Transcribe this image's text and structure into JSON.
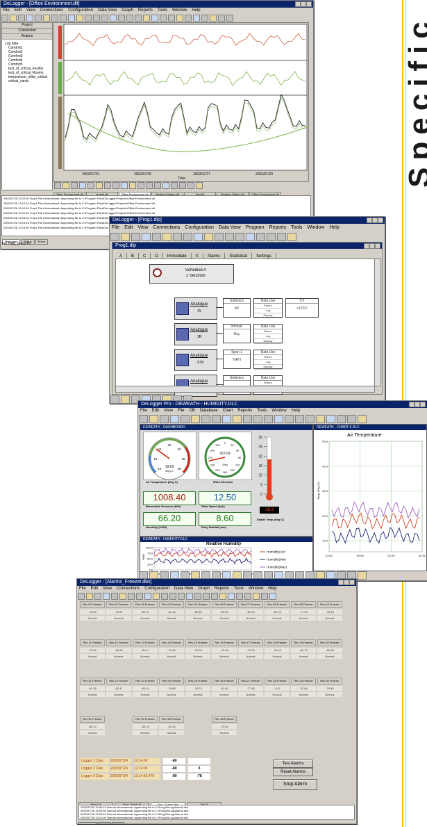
{
  "side_title": "Specific",
  "colors": {
    "accent_line": "#f5c400",
    "title_bar": "#0a246a",
    "red_series": "#c86040",
    "green_series": "#7fb24a",
    "dark_series": "#303030"
  },
  "win1": {
    "title": "DeLogger - [Office Environment.dlt]",
    "menu": [
      "File",
      "Edit",
      "View",
      "Connections",
      "Configuration",
      "Data View",
      "Graph",
      "Reports",
      "Tools",
      "Window",
      "Help"
    ],
    "panel_header": "Project",
    "panel_rows": [
      "Connection",
      "Actions"
    ],
    "tree_items": [
      "Log data",
      "Comfort1",
      "Comfort2",
      "Comfort3",
      "Comfort4",
      "Comfort5",
      "test_of_critical_Facility",
      "test_of_critical_Rooms",
      "tempsensor_slide_critical",
      "critical_cards"
    ],
    "axis_dates": [
      "2002/07/23",
      "2002/07/25",
      "2002/07/27",
      "2002/07/29"
    ],
    "axis_title": "Time",
    "tabs": [
      "Office Environment.dlt",
      "Humid.dlt",
      "Office Environment.dlt",
      "Weather Station.dlt",
      "Test.dlt",
      "Weather Station.dlt",
      "Office Environment.dlt",
      "Office Environment.dlt"
    ],
    "log_rows": [
      "2002/07/26 13:12:00 Prop1 File Informational: Appending file to C:\\Program Files\\DeLogger\\Projects\\Office Environment.dlt",
      "2002/07/26 13:12:15 Prop1 File Informational: Appending file to C:\\Program Files\\DeLogger\\Projects\\Office Environment.dlt",
      "2002/07/26 13:12:30 Prop1 File Informational: Appending file to C:\\Program Files\\DeLogger\\Projects\\Office Environment.dlt",
      "2002/07/26 13:12:45 Prop1 File Informational: Appending file to C:\\Program Files\\DeLogger\\Projects\\Office Environment.dlt",
      "2002/07/26 13:13:00 Prop1 File Informational: Appending file to C:\\Program Files\\DeLogger\\Projects\\Office Environment.dlt",
      "2002/07/26 13:13:15 Prop1 File Informational: Appending file to C:\\Program Files\\DeLogger\\Projects\\Office Environment.dlt",
      "2002/07/26 13:13:30 Prop1 File Informational: Appending file to C:\\Program Files\\DeLogger\\Projects\\Office Environment.dlt"
    ],
    "bottom_tabs": [
      "Messages",
      "Status",
      "Errors"
    ],
    "status": "For Help, press F1"
  },
  "win2": {
    "title": "DeLogger - [Prog1.dlp]",
    "menu": [
      "File",
      "Edit",
      "View",
      "Connections",
      "Configuration",
      "Data View",
      "Program",
      "Reports",
      "Tools",
      "Window",
      "Help"
    ],
    "inner_title": "Prog1.dlp",
    "tabs": [
      "A",
      "B",
      "C",
      "D",
      "Immediate",
      "X",
      "Alarms",
      "Statistical",
      "Settings"
    ],
    "schedule": {
      "name": "Schedule A",
      "rate": "1 Seconds"
    },
    "rows": [
      {
        "sensor": "Analogue",
        "range": "1V",
        "stat": "Statistics",
        "stat_val": "AV",
        "use": "Data Use",
        "use_items": [
          "Return",
          "Log",
          "Display"
        ],
        "extra": "CV",
        "extra_val": "<12CV"
      },
      {
        "sensor": "Analogue",
        "range": "3R",
        "stat": "Intrinsic",
        "stat_val": "Day",
        "use": "Data Use",
        "use_items": [
          "Return",
          "Log",
          "Display"
        ],
        "extra": "",
        "extra_val": ""
      },
      {
        "sensor": "Analogue",
        "range": "STK",
        "stat": "Span 1",
        "stat_val": "%RH",
        "use": "Data Use",
        "use_items": [
          "Return",
          "Log",
          "Display"
        ],
        "extra": "",
        "extra_val": ""
      },
      {
        "sensor": "Analogue",
        "range": "",
        "stat": "Statistics",
        "stat_val": "",
        "use": "Data Use",
        "use_items": [
          "Return"
        ],
        "extra": "",
        "extra_val": ""
      }
    ]
  },
  "win3": {
    "title": "DeLogger Pro - DEWEATH - HUMIDITY.DLC",
    "menu": [
      "File",
      "Edit",
      "View",
      "File",
      "DB",
      "Database",
      "Chart",
      "Reports",
      "Tools",
      "Window",
      "Help"
    ],
    "panel1_title": "DEWEATH - DASHBOARD",
    "panel2_title": "DEWEATH - CHART 6.DLC",
    "panel3_title": "DEWEATH - HUMIDITY.DLC",
    "gauge1": {
      "label": "Air Temperature (Deg C)",
      "value": "19.00",
      "unit": "Deg C",
      "ticks": [
        "10",
        "15",
        "20",
        "25",
        "30",
        "35",
        "40"
      ],
      "reading": 19.0,
      "min": 10,
      "max": 40
    },
    "gauge2": {
      "label": "Wind Direction",
      "value": "257.09",
      "unit": "Deg",
      "ticks": [
        "300",
        "330",
        "0",
        "30",
        "60",
        "90",
        "120",
        "150",
        "180",
        "210",
        "240",
        "270"
      ],
      "reading": 257.09
    },
    "thermo": {
      "label": "Shade Temp (Deg C)",
      "ticks": [
        "30",
        "25",
        "20",
        "15",
        "10",
        "5",
        "0"
      ],
      "reading": "18.3",
      "value": 18.3
    },
    "digits": [
      {
        "value": "1008.40",
        "label": "Barometric Pressure (hPa)",
        "color": "#a02010"
      },
      {
        "value": "12.50",
        "label": "Wind Speed (kph)",
        "color": "#1a5fa0"
      },
      {
        "value": "66.20",
        "label": "Humidity (%RH)",
        "color": "#2a7a20"
      },
      {
        "value": "8.60",
        "label": "Daily Rainfall (mm)",
        "color": "#2a7a20"
      }
    ],
    "rh_title": "Relative Humidity",
    "rh_legend": [
      "Humidity(Avr)",
      "Humidity(Min)",
      "Humidity(Max)"
    ],
    "rh_x": [
      "00:01:45",
      "00:02:05",
      "00:02:25",
      "00:02:45"
    ],
    "rh_y": [
      "100.0",
      "75.0",
      "50.0",
      "25.0",
      "0.0"
    ],
    "rh_ylabel": "%RH",
    "air_title": "Air Temperature",
    "air_y": [
      "50.0",
      "40.0",
      "30.0",
      "20.0",
      "10.0"
    ],
    "air_x": [
      "01:01",
      "02:06",
      "02:29",
      "02:31"
    ],
    "air_ylabel": "Temp (Deg C)",
    "status": "For Help, press F1"
  },
  "win4": {
    "title": "DeLogger - [Alarms_Freezer.dbx]",
    "menu": [
      "File",
      "Edit",
      "View",
      "Connections",
      "Configuration",
      "Data View",
      "Graph",
      "Reports",
      "Tools",
      "Window",
      "Help"
    ],
    "rows": [
      [
        {
          "h": "Rev 01 Freezer",
          "v": "-78.94",
          "s": "Normal"
        },
        {
          "h": "Rev 02 Freezer",
          "v": "-79.87",
          "s": "Normal"
        },
        {
          "h": "Rev 03 Freezer",
          "v": "-80.15",
          "s": "Normal"
        },
        {
          "h": "Rev 04 Freezer",
          "v": "-81.43",
          "s": "Normal"
        },
        {
          "h": "Rev 05 Freezer",
          "v": "-81.84",
          "s": "Normal"
        },
        {
          "h": "Rev 06 Freezer",
          "v": "-81.80",
          "s": "Normal"
        },
        {
          "h": "Rev 07 Freezer",
          "v": "-80.13",
          "s": "Normal"
        },
        {
          "h": "Rev 08 Freezer",
          "v": "-81.76",
          "s": "Normal"
        },
        {
          "h": "Rev 09 Freezer",
          "v": "-77.49",
          "s": "Normal"
        },
        {
          "h": "Rev 10 Freezer",
          "v": "-78.40",
          "s": "Normal"
        }
      ],
      [
        {
          "h": "Rev 11 Freezer",
          "v": "-79.34",
          "s": "Normal"
        },
        {
          "h": "Rev 12 Freezer",
          "v": "-80.34",
          "s": "Normal"
        },
        {
          "h": "Rev 13 Freezer",
          "v": "-80.47",
          "s": "Normal"
        },
        {
          "h": "Rev 14 Freezer",
          "v": "-79.99",
          "s": "Normal"
        },
        {
          "h": "Rev 15 Freezer",
          "v": "-79.99",
          "s": "Normal"
        },
        {
          "h": "Rev 16 Freezer",
          "v": "-79.63",
          "s": "Normal"
        },
        {
          "h": "Rev 17 Freezer",
          "v": "-79.70",
          "s": "Normal"
        },
        {
          "h": "Rev 18 Freezer",
          "v": "-79.43",
          "s": "Normal"
        },
        {
          "h": "Rev 19 Freezer",
          "v": "-80.79",
          "s": "Normal"
        },
        {
          "h": "Rev 20 Freezer",
          "v": "-80.43",
          "s": "Normal"
        }
      ],
      [
        {
          "h": "Rev 21 Freezer",
          "v": "-81.35",
          "s": "Normal"
        },
        {
          "h": "Rev 22 Freezer",
          "v": "-82.41",
          "s": "Normal"
        },
        {
          "h": "Rev 23 Freezer",
          "v": "-80.41",
          "s": "Normal"
        },
        {
          "h": "Rev 24 Freezer",
          "v": "-79.88",
          "s": "Normal"
        },
        {
          "h": "Rev 25 Freezer",
          "v": "-78.72",
          "s": "Normal"
        },
        {
          "h": "Rev 26 Freezer",
          "v": "-81.60",
          "s": "Normal"
        },
        {
          "h": "Rev 27 Freezer",
          "v": "-77.46",
          "s": "Normal"
        },
        {
          "h": "Rev 28 Freezer",
          "v": "-4.47",
          "s": "Normal"
        },
        {
          "h": "Rev 29 Freezer",
          "v": "-22.84",
          "s": "Normal"
        },
        {
          "h": "Rev 30 Freezer",
          "v": "-23.40",
          "s": "Normal"
        }
      ],
      [
        {
          "h": "Rev 31 Freezer",
          "v": "-80.10",
          "s": "Normal"
        },
        {
          "h": "",
          "v": "",
          "s": ""
        },
        {
          "h": "Rev 33 Freezer",
          "v": "-80.15",
          "s": "Normal"
        },
        {
          "h": "Rev 34 Freezer",
          "v": "-81.30",
          "s": "Normal"
        },
        {
          "h": "",
          "v": "",
          "s": ""
        },
        {
          "h": "Rev 36 Freezer",
          "v": "-79.50",
          "s": "Normal"
        }
      ]
    ],
    "loggers": [
      {
        "name": "Logger 1 Date",
        "date": "2002/07/24",
        "time": "12:14:00",
        "a": "-80",
        "b": ""
      },
      {
        "name": "Logger 2 Date",
        "date": "2002/07/24",
        "time": "12:14:00",
        "a": "-80",
        "b": "0"
      },
      {
        "name": "Logger 3 Date",
        "date": "2002/07/24",
        "time": "12:14:53:475",
        "a": "-80",
        "b": "-78"
      }
    ],
    "buttons": [
      "Test Alarms",
      "Reset Alarms",
      "Stop Alarm"
    ],
    "tabs": [
      "Fresh.dt",
      "Freq_Graph.dt",
      "Freq_Screen.dbx",
      "Test.dt"
    ],
    "log_rows": [
      "2002/07/26 13:09:15 Normal Informational: Appending file to C:\\Prog\\DeLog\\Alarms.dbx",
      "2002/07/26 13:09:30 Normal Informational: Appending file to C:\\Prog\\DeLog\\Alarms.dbx",
      "2002/07/26 13:09:45 Normal Informational: Appending file to C:\\Prog\\DeLog\\Alarms.dbx",
      "2002/07/26 13:10:00 Normal Informational: Appending file to C:\\Prog\\DeLog\\Alarms.dbx"
    ],
    "bottom_tabs": [
      "Messages",
      "Status",
      "Errors"
    ]
  }
}
